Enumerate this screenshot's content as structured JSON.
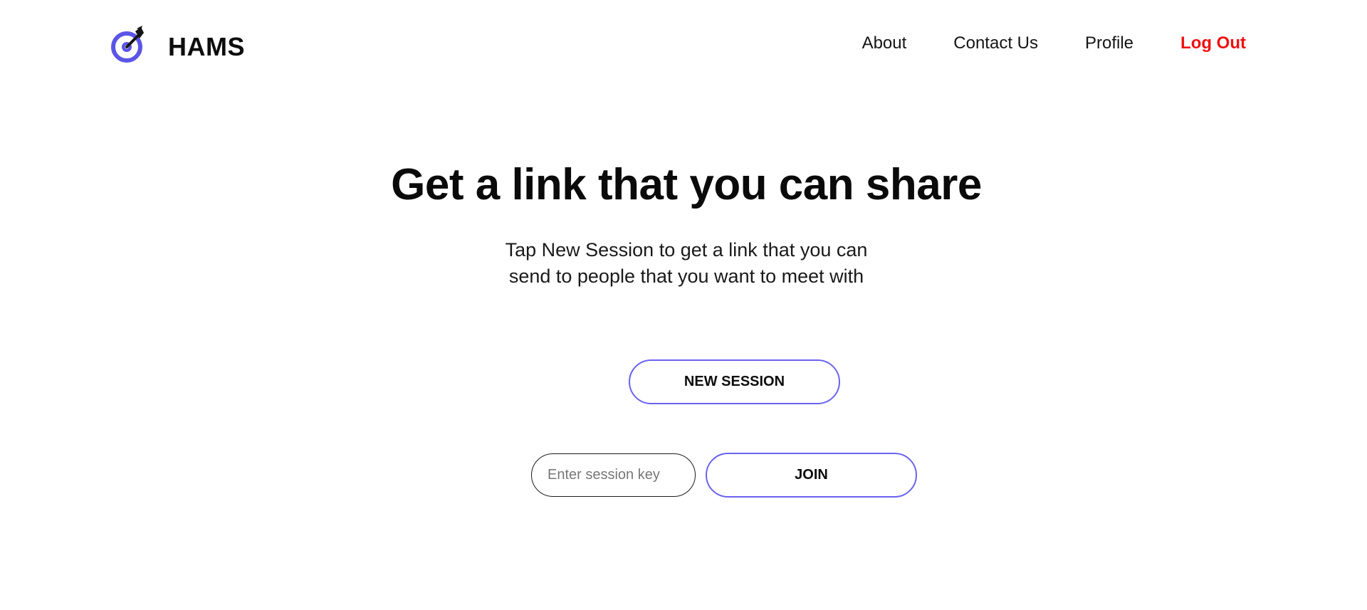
{
  "brand": {
    "name": "HAMS",
    "logo_icon": "target-dart-icon",
    "accent_color": "#5b55e6"
  },
  "nav": {
    "about": "About",
    "contact": "Contact Us",
    "profile": "Profile",
    "logout": "Log Out",
    "logout_color": "#ee1111"
  },
  "hero": {
    "title": "Get a link that you can share",
    "subtitle": "Tap New Session to get a link that you can send to people that you want to meet with"
  },
  "actions": {
    "new_session_label": "NEW SESSION",
    "session_key_placeholder": "Enter session key",
    "session_key_value": "",
    "join_label": "JOIN",
    "button_border_color": "#6b63ef"
  }
}
